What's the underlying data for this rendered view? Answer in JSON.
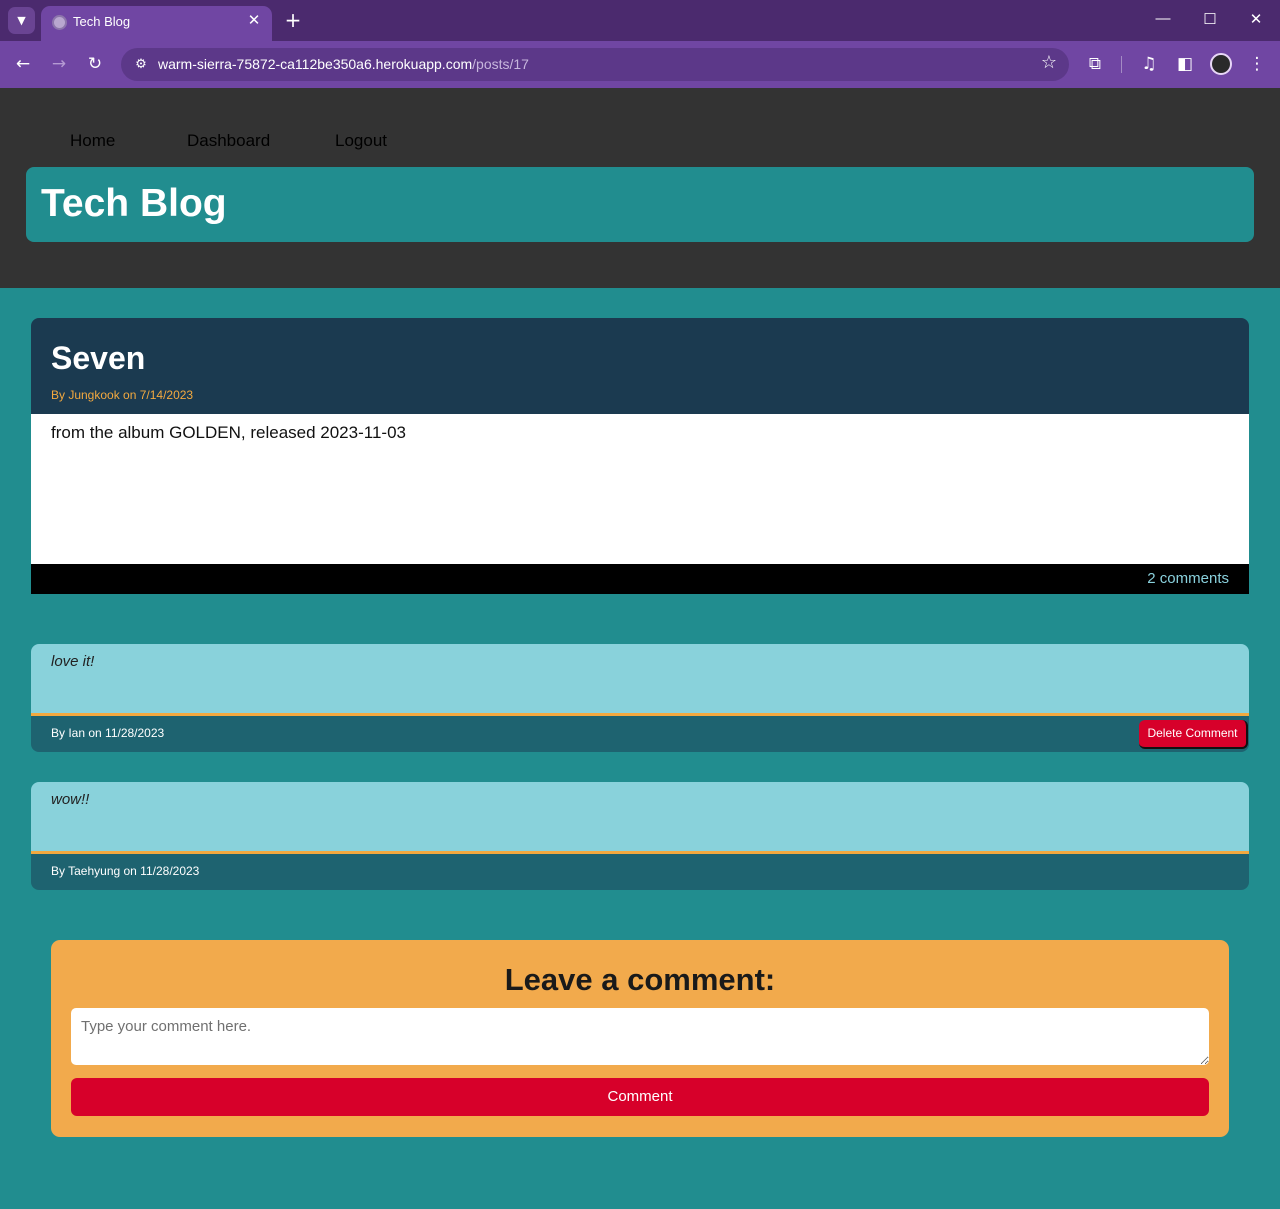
{
  "browser": {
    "tab_title": "Tech Blog",
    "url_host": "warm-sierra-75872-ca112be350a6.herokuapp.com",
    "url_path": "/posts/17",
    "icons": {
      "tab_search": "chevron-down-icon",
      "favicon": "globe-icon",
      "tab_close": "close-icon",
      "new_tab": "plus-icon",
      "minimize": "minimize-icon",
      "maximize": "maximize-icon",
      "close": "close-icon",
      "back": "arrow-left-icon",
      "forward": "arrow-right-icon",
      "reload": "reload-icon",
      "site_info": "tune-icon",
      "bookmark": "star-icon",
      "extensions": "puzzle-icon",
      "media": "media-control-icon",
      "side_panel": "side-panel-icon",
      "profile": "avatar-icon",
      "menu": "kebab-menu-icon"
    }
  },
  "nav": {
    "home": "Home",
    "dashboard": "Dashboard",
    "logout": "Logout"
  },
  "site": {
    "title": "Tech Blog"
  },
  "post": {
    "title": "Seven",
    "meta": "By Jungkook on 7/14/2023",
    "content": "from the album GOLDEN, released 2023-11-03",
    "comment_count": "2 comments"
  },
  "comments": [
    {
      "text": "love it!",
      "meta": "By Ian on 11/28/2023",
      "delete_label": "Delete Comment"
    },
    {
      "text": "wow!!",
      "meta": "By Taehyung on 11/28/2023"
    }
  ],
  "form": {
    "title": "Leave a comment:",
    "placeholder": "Type your comment here.",
    "button_label": "Comment"
  },
  "colors": {
    "chrome_tabbar": "#4b2a6e",
    "chrome_toolbar": "#7046a3",
    "header_bg": "#333333",
    "teal": "#218d8f",
    "post_header": "#1b3a50",
    "accent_orange": "#f3a93f",
    "comment_body": "#89d2db",
    "comment_footer": "#1e6370",
    "button_red": "#d7002a"
  }
}
